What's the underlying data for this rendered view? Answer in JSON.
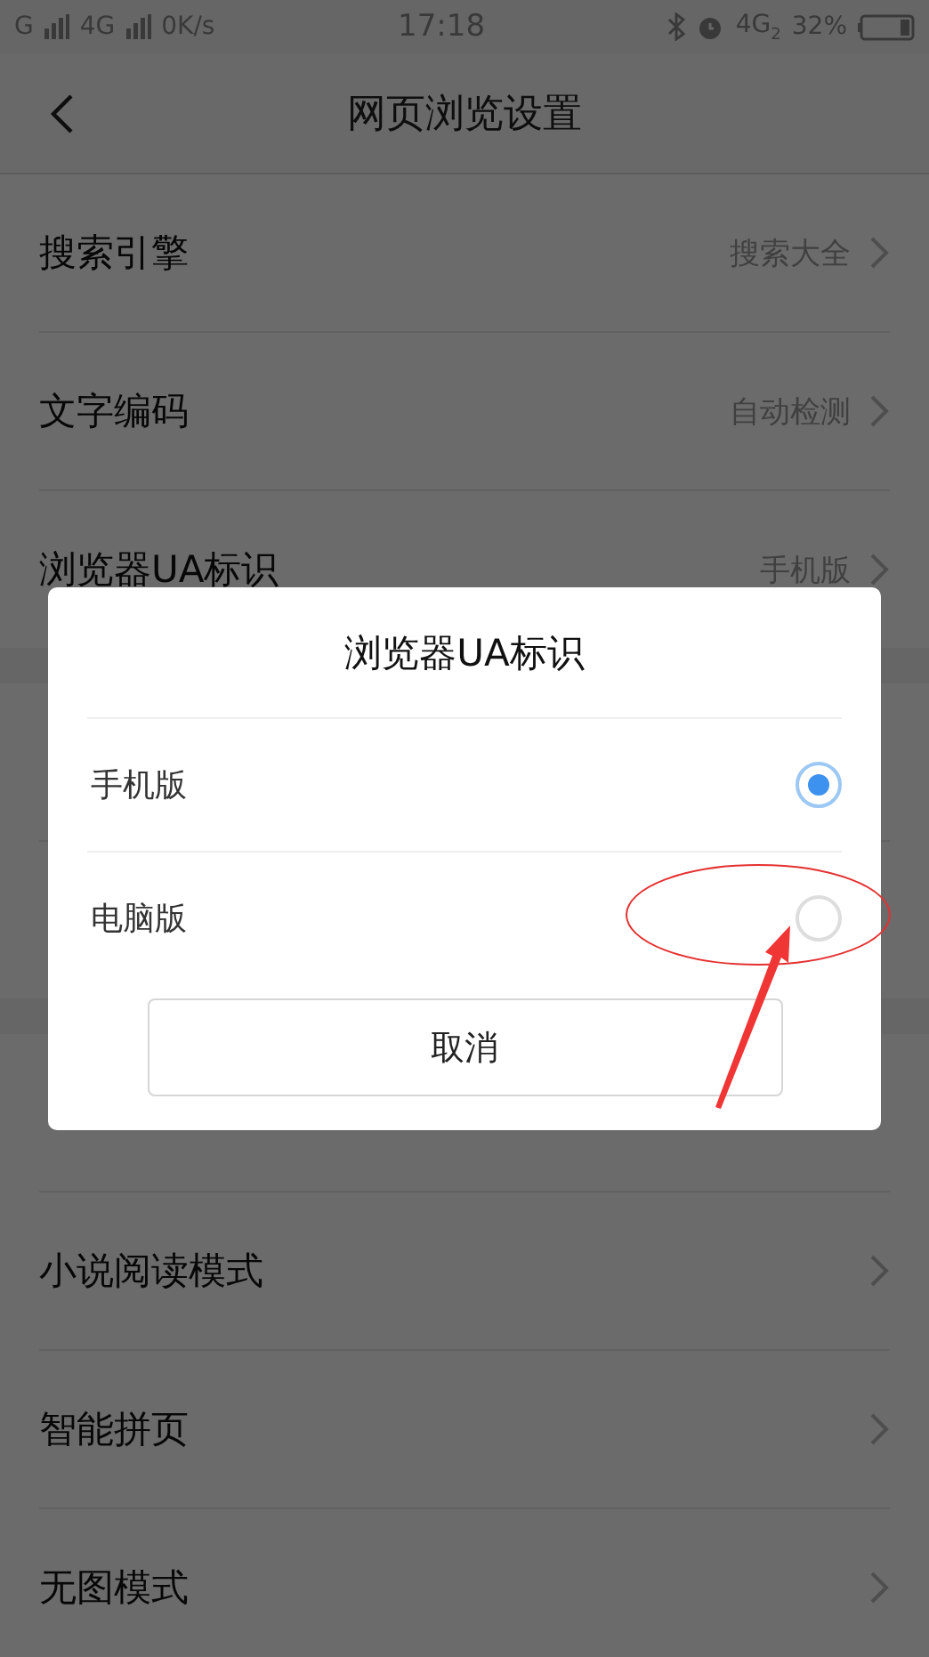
{
  "status_bar": {
    "carrier_1": "G",
    "carrier_2": "4G",
    "speed": "0K/s",
    "time": "17:18",
    "network": "4G",
    "network_sub": "2",
    "battery": "32%"
  },
  "header": {
    "title": "网页浏览设置"
  },
  "groups": [
    {
      "rows": [
        {
          "label": "搜索引擎",
          "value": "搜索大全"
        },
        {
          "label": "文字编码",
          "value": "自动检测"
        },
        {
          "label": "浏览器UA标识",
          "value": "手机版"
        }
      ]
    },
    {
      "rows": [
        {},
        {}
      ]
    },
    {
      "rows": [
        {},
        {
          "label": "小说阅读模式"
        },
        {
          "label": "智能拼页"
        },
        {
          "label": "无图模式"
        }
      ]
    }
  ],
  "dialog": {
    "title": "浏览器UA标识",
    "options": [
      {
        "label": "手机版",
        "selected": true
      },
      {
        "label": "电脑版",
        "selected": false
      }
    ],
    "cancel": "取消"
  }
}
